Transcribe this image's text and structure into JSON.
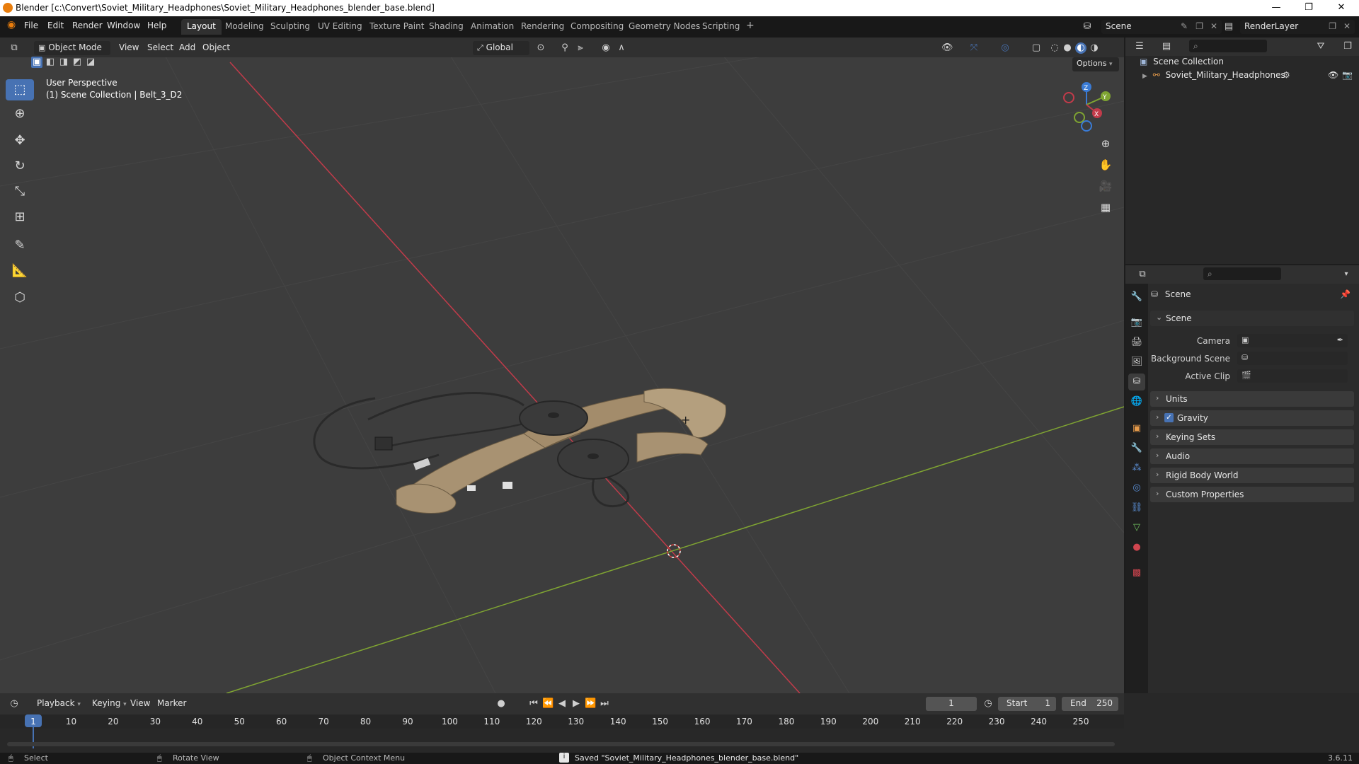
{
  "window": {
    "title": "Blender [c:\\Convert\\Soviet_Military_Headphones\\Soviet_Military_Headphones_blender_base.blend]",
    "minimize": "—",
    "maximize": "❐",
    "close": "✕"
  },
  "menu": {
    "file": "File",
    "edit": "Edit",
    "render": "Render",
    "window": "Window",
    "help": "Help"
  },
  "workspaces": [
    "Layout",
    "Modeling",
    "Sculpting",
    "UV Editing",
    "Texture Paint",
    "Shading",
    "Animation",
    "Rendering",
    "Compositing",
    "Geometry Nodes",
    "Scripting"
  ],
  "workspace_add": "+",
  "scene_field": "Scene",
  "view_layer_field": "RenderLayer",
  "viewport_header": {
    "mode": "Object Mode",
    "view": "View",
    "select": "Select",
    "add": "Add",
    "object": "Object",
    "orientation": "Global",
    "options": "Options"
  },
  "viewport": {
    "perspective": "User Perspective",
    "collection": "(1) Scene Collection | Belt_3_D2",
    "gizmo_axes": {
      "x": "X",
      "y": "Y",
      "z": "Z"
    }
  },
  "outliner": {
    "scene_collection": "Scene Collection",
    "items": [
      {
        "label": "Soviet_Military_Headphones"
      }
    ]
  },
  "properties": {
    "context": "Scene",
    "section": "Scene",
    "camera_label": "Camera",
    "background_scene_label": "Background Scene",
    "active_clip_label": "Active Clip",
    "panels": [
      "Units",
      "Gravity",
      "Keying Sets",
      "Audio",
      "Rigid Body World",
      "Custom Properties"
    ],
    "gravity_checked": true
  },
  "timeline": {
    "playback": "Playback",
    "keying": "Keying",
    "view": "View",
    "marker": "Marker",
    "current_frame": "1",
    "start_label": "Start",
    "start_value": "1",
    "end_label": "End",
    "end_value": "250",
    "frames": [
      "1",
      "10",
      "20",
      "30",
      "40",
      "50",
      "60",
      "70",
      "80",
      "90",
      "100",
      "110",
      "120",
      "130",
      "140",
      "150",
      "160",
      "170",
      "180",
      "190",
      "200",
      "210",
      "220",
      "230",
      "240",
      "250"
    ]
  },
  "statusbar": {
    "select": "Select",
    "rotate": "Rotate View",
    "context_menu": "Object Context Menu",
    "message": "Saved \"Soviet_Military_Headphones_blender_base.blend\"",
    "version": "3.6.11"
  },
  "colors": {
    "accent": "#4772b3",
    "x_axis": "#c23b4a",
    "y_axis": "#7fa432",
    "z_axis": "#3a7bd5",
    "belt": "#a89272",
    "earcup": "#3a3a3a"
  }
}
